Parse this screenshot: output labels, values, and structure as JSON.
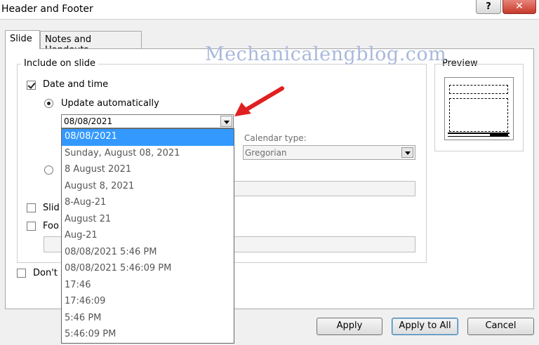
{
  "window": {
    "title": "Header and Footer",
    "help_label": "?",
    "close_label": "✕"
  },
  "tabs": [
    {
      "label": "Slide",
      "active": true
    },
    {
      "label": "Notes and Handouts",
      "active": false
    }
  ],
  "include": {
    "group_label": "Include on slide",
    "date_time": {
      "label": "Date and time",
      "checked": true
    },
    "update_auto": {
      "label": "Update automatically",
      "selected": true
    },
    "date_value": "08/08/2021",
    "calendar_label": "Calendar type:",
    "calendar_value": "Gregorian",
    "slide_number_label_partial": "Slid",
    "footer_label_partial": "Foo",
    "dont_show_partial": "Don't"
  },
  "dropdown_options": [
    "08/08/2021",
    "Sunday, August 08, 2021",
    "8 August 2021",
    "August 8, 2021",
    "8-Aug-21",
    "August 21",
    "Aug-21",
    "08/08/2021 5:46 PM",
    "08/08/2021 5:46:09 PM",
    "17:46",
    "17:46:09",
    "5:46 PM",
    "5:46:09 PM"
  ],
  "preview": {
    "label": "Preview"
  },
  "buttons": {
    "apply": "Apply",
    "apply_all": "Apply to All",
    "cancel": "Cancel"
  },
  "watermark": "Mechanicalengblog.com",
  "colors": {
    "selection": "#3399ff",
    "arrow": "#e02020",
    "watermark": "#a9b8dc"
  },
  "icons": {
    "arrow": "red-arrow-icon",
    "checkmark": "checkmark-icon"
  }
}
